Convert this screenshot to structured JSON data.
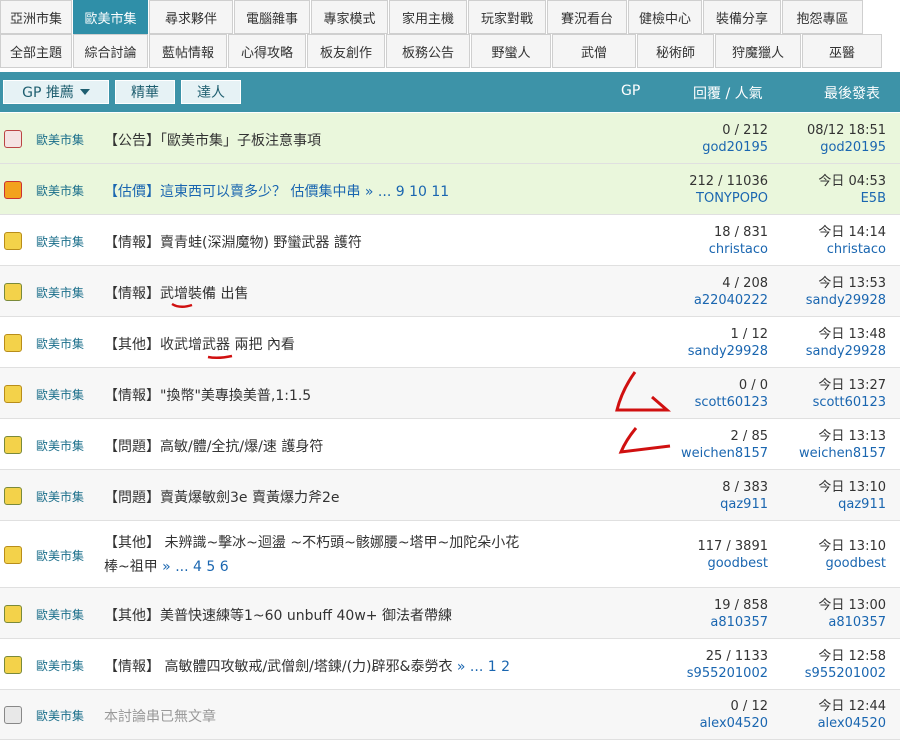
{
  "tabs_row1": [
    "亞洲市集",
    "歐美市集",
    "尋求夥伴",
    "電腦雜事",
    "專家模式",
    "家用主機",
    "玩家對戰",
    "賽況看台",
    "健檢中心",
    "裝備分享",
    "抱怨專區"
  ],
  "tabs_row2": [
    "全部主題",
    "綜合討論",
    "藍帖情報",
    "心得攻略",
    "板友創作",
    "板務公告",
    "野蠻人",
    "武僧",
    "秘術師",
    "狩魔獵人",
    "巫醫"
  ],
  "header": {
    "gp_button": "GP 推薦",
    "jinghua": "精華",
    "daren": "達人",
    "col_gp": "GP",
    "col_replies": "回覆 / 人氣",
    "col_last": "最後發表"
  },
  "rows": [
    {
      "board": "歐美市集",
      "title": "【公告】「歐美市集」子板注意事項",
      "pages": "",
      "stats": "0 / 212",
      "author": "god20195",
      "time": "08/12 18:51",
      "last_user": "god20195"
    },
    {
      "board": "歐美市集",
      "title": "【估價】這東西可以賣多少？ 估價集中串",
      "pages": " » ... 9  10  11",
      "stats": "212 / 11036",
      "author": "TONYPOPO",
      "time": "今日 04:53",
      "last_user": "E5B"
    },
    {
      "board": "歐美市集",
      "title": "【情報】賣青蛙(深淵魔物) 野蠻武器 護符",
      "pages": "",
      "stats": "18 / 831",
      "author": "christaco",
      "time": "今日 14:14",
      "last_user": "christaco"
    },
    {
      "board": "歐美市集",
      "title": "【情報】武增裝備 出售",
      "pages": "",
      "stats": "4 / 208",
      "author": "a22040222",
      "time": "今日 13:53",
      "last_user": "sandy29928"
    },
    {
      "board": "歐美市集",
      "title": "【其他】收武增武器 兩把 內看",
      "pages": "",
      "stats": "1 / 12",
      "author": "sandy29928",
      "time": "今日 13:48",
      "last_user": "sandy29928"
    },
    {
      "board": "歐美市集",
      "title": "【情報】\"換幣\"美專換美普,1:1.5",
      "pages": "",
      "stats": "0 / 0",
      "author": "scott60123",
      "time": "今日 13:27",
      "last_user": "scott60123"
    },
    {
      "board": "歐美市集",
      "title": "【問題】高敏/體/全抗/爆/速 護身符",
      "pages": "",
      "stats": "2 / 85",
      "author": "weichen8157",
      "time": "今日 13:13",
      "last_user": "weichen8157"
    },
    {
      "board": "歐美市集",
      "title": "【問題】賣黃爆敏劍3e 賣黃爆力斧2e",
      "pages": "",
      "stats": "8 / 383",
      "author": "qaz911",
      "time": "今日 13:10",
      "last_user": "qaz911"
    },
    {
      "board": "歐美市集",
      "title": "【其他】 未辨識~擊冰~迴盪 ~不朽頭~骸娜腰~塔甲~加陀朵小花",
      "title2": "棒~祖甲",
      "pages": " » ... 4  5  6",
      "stats": "117 / 3891",
      "author": "goodbest",
      "time": "今日 13:10",
      "last_user": "goodbest"
    },
    {
      "board": "歐美市集",
      "title": "【其他】美普快速練等1~60 unbuff 40w+ 御法者帶練",
      "pages": "",
      "stats": "19 / 858",
      "author": "a810357",
      "time": "今日 13:00",
      "last_user": "a810357"
    },
    {
      "board": "歐美市集",
      "title": "【情報】 高敏體四攻敏戒/武僧劍/塔鍊/(力)辟邪&泰勞衣",
      "pages": " » ... 1  2",
      "stats": "25 / 1133",
      "author": "s955201002",
      "time": "今日 12:58",
      "last_user": "s955201002"
    },
    {
      "board": "歐美市集",
      "title": "本討論串已無文章",
      "pages": "",
      "stats": "0 / 12",
      "author": "alex04520",
      "time": "今日 12:44",
      "last_user": "alex04520"
    }
  ],
  "colors": {
    "accent": "#3d93a8",
    "active_tab": "#2f8fa8",
    "link": "#1a66b0",
    "highlight": "#eaf7dc",
    "annotation": "#d01010"
  }
}
